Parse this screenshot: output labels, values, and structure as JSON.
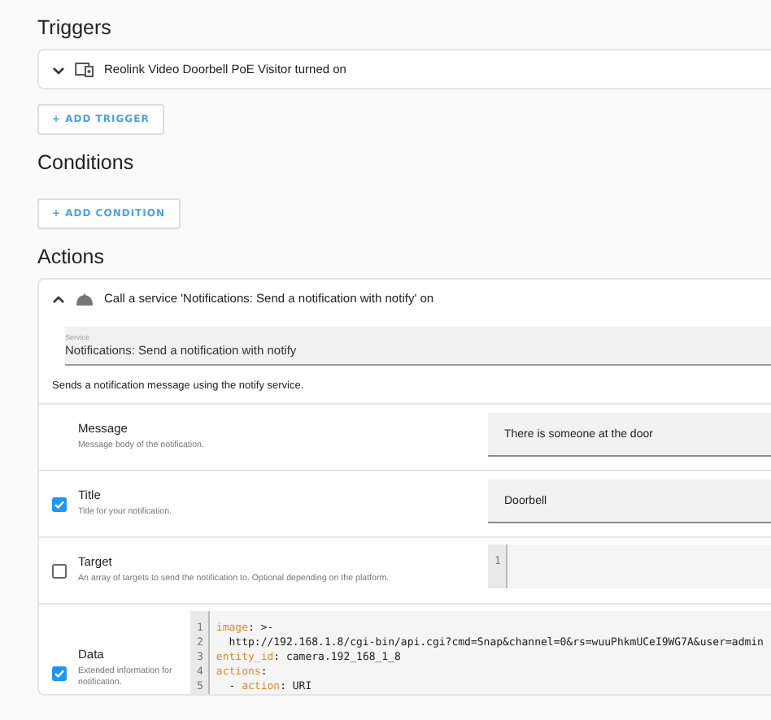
{
  "triggers": {
    "heading": "Triggers",
    "items": [
      {
        "label": "Reolink Video Doorbell PoE Visitor turned on",
        "expanded": false
      }
    ],
    "add_button": "+ ADD TRIGGER"
  },
  "conditions": {
    "heading": "Conditions",
    "add_button": "+ ADD CONDITION"
  },
  "actions": {
    "heading": "Actions",
    "items": [
      {
        "label": "Call a service 'Notifications: Send a notification with notify' on",
        "expanded": true,
        "service": {
          "label": "Service",
          "value": "Notifications: Send a notification with notify"
        },
        "description": "Sends a notification message using the notify service.",
        "fields": [
          {
            "kind": "text",
            "name": "Message",
            "description": "Message body of the notification.",
            "value": "There is someone at the door"
          },
          {
            "kind": "text",
            "checked": true,
            "name": "Title",
            "description": "Title for your notification.",
            "value": "Doorbell"
          },
          {
            "kind": "code",
            "checked": false,
            "name": "Target",
            "description": "An array of targets to send the notification to. Optional depending on the platform.",
            "lines": [
              {
                "number": "1"
              }
            ]
          },
          {
            "kind": "code",
            "checked": true,
            "name": "Data",
            "description": "Extended information for notification.",
            "lines": [
              {
                "number": "1",
                "tokens": [
                  {
                    "kind": "key",
                    "text": "image"
                  },
                  {
                    "kind": "plain",
                    "text": ": >-"
                  }
                ]
              },
              {
                "number": "2",
                "tokens": [
                  {
                    "kind": "plain",
                    "text": "  http://192.168.1.8/cgi-bin/api.cgi?cmd=Snap&channel=0&rs=wuuPhkmUCeI9WG7A&user=admin"
                  }
                ]
              },
              {
                "number": "3",
                "tokens": [
                  {
                    "kind": "key",
                    "text": "entity_id"
                  },
                  {
                    "kind": "plain",
                    "text": ": camera.192_168_1_8"
                  }
                ]
              },
              {
                "number": "4",
                "tokens": [
                  {
                    "kind": "key",
                    "text": "actions"
                  },
                  {
                    "kind": "plain",
                    "text": ":"
                  }
                ]
              },
              {
                "number": "5",
                "tokens": [
                  {
                    "kind": "plain",
                    "text": "  - "
                  },
                  {
                    "kind": "key",
                    "text": "action"
                  },
                  {
                    "kind": "plain",
                    "text": ": URI"
                  }
                ]
              }
            ]
          }
        ]
      }
    ]
  }
}
